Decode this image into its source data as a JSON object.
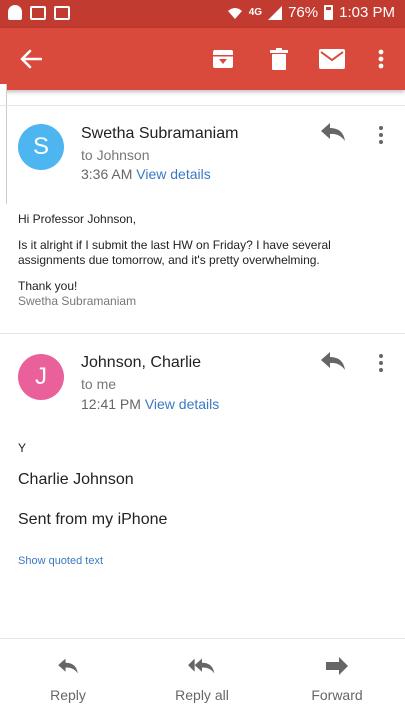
{
  "status_bar": {
    "network": "4G",
    "battery": "76%",
    "time": "1:03 PM"
  },
  "toolbar": {
    "icons": [
      "back-arrow-icon",
      "archive-icon",
      "trash-icon",
      "mail-icon",
      "more-vert-icon"
    ]
  },
  "messages": [
    {
      "avatar_letter": "S",
      "avatar_color": "#4db6f0",
      "sender": "Swetha Subramaniam",
      "to": "to Johnson",
      "time": "3:36 AM",
      "details_link": "View details",
      "body": {
        "greeting": "Hi Professor Johnson,",
        "paragraph": "Is it alright if I submit the last HW on Friday? I have several assignments due tomorrow, and it's pretty overwhelming.",
        "closing": "Thank you!",
        "signature": "Swetha Subramaniam"
      }
    },
    {
      "avatar_letter": "J",
      "avatar_color": "#e9609a",
      "sender": "Johnson, Charlie",
      "to": "to me",
      "time": "12:41 PM",
      "details_link": "View details",
      "body": {
        "line1": "Y",
        "line2": "Charlie Johnson",
        "line3": "Sent from my iPhone",
        "show_quoted": "Show quoted text"
      }
    }
  ],
  "bottom_actions": {
    "reply": "Reply",
    "reply_all": "Reply all",
    "forward": "Forward"
  },
  "colors": {
    "status_bar": "#c23b30",
    "toolbar": "#d94a3c",
    "link": "#3b78c4"
  }
}
